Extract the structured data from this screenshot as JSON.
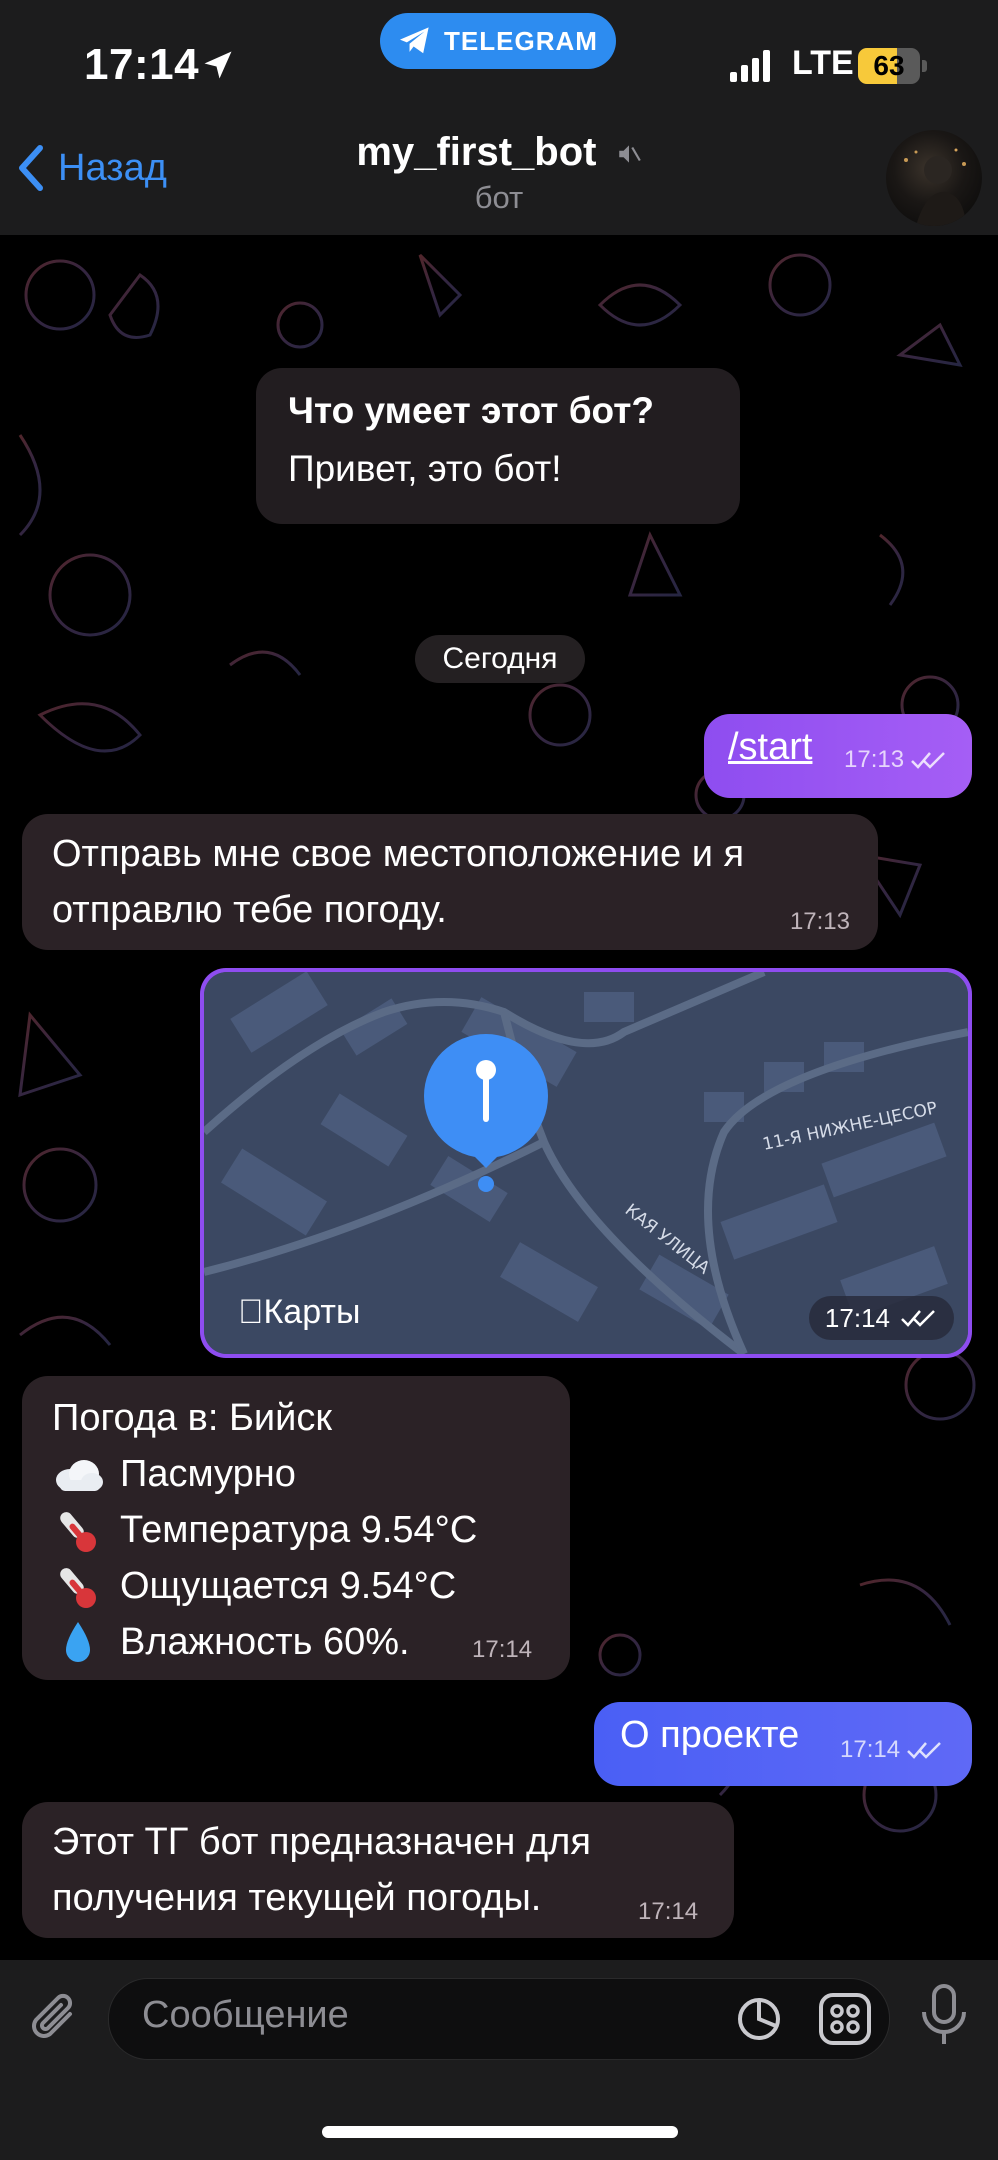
{
  "status_bar": {
    "time": "17:14",
    "network": "LTE",
    "battery": "63",
    "app_pill": "TELEGRAM"
  },
  "header": {
    "back_label": "Назад",
    "title": "my_first_bot",
    "subtitle": "бот"
  },
  "chat": {
    "intro": {
      "title": "Что умеет этот бот?",
      "text": "Привет, это бот!"
    },
    "date_label": "Сегодня",
    "messages": [
      {
        "text": "/start",
        "time": "17:13"
      },
      {
        "line1": "Отправь мне свое местоположение и я",
        "line2": "отправлю тебе погоду.",
        "time": "17:13"
      },
      {
        "map_brand": "Карты",
        "street_1": "11-Я НИЖНЕ-ЦЕСОР",
        "street_2": "КАЯ УЛИЦА",
        "time": "17:14"
      },
      {
        "line1": "Погода в: Бийск",
        "line2": "Пасмурно",
        "line3": "Температура 9.54°C",
        "line4": "Ощущается 9.54°C",
        "line5": "Влажность 60%.",
        "time": "17:14"
      },
      {
        "text": "О проекте",
        "time": "17:14"
      },
      {
        "line1": "Этот ТГ бот предназначен для",
        "line2": "получения текущей погоды.",
        "time": "17:14"
      }
    ]
  },
  "input": {
    "placeholder": "Сообщение"
  },
  "colors": {
    "accent": "#3c8ff5",
    "outgoing": "#8e4df0",
    "outgoing_alt": "#4a5ff5",
    "incoming": "#2b2226"
  }
}
